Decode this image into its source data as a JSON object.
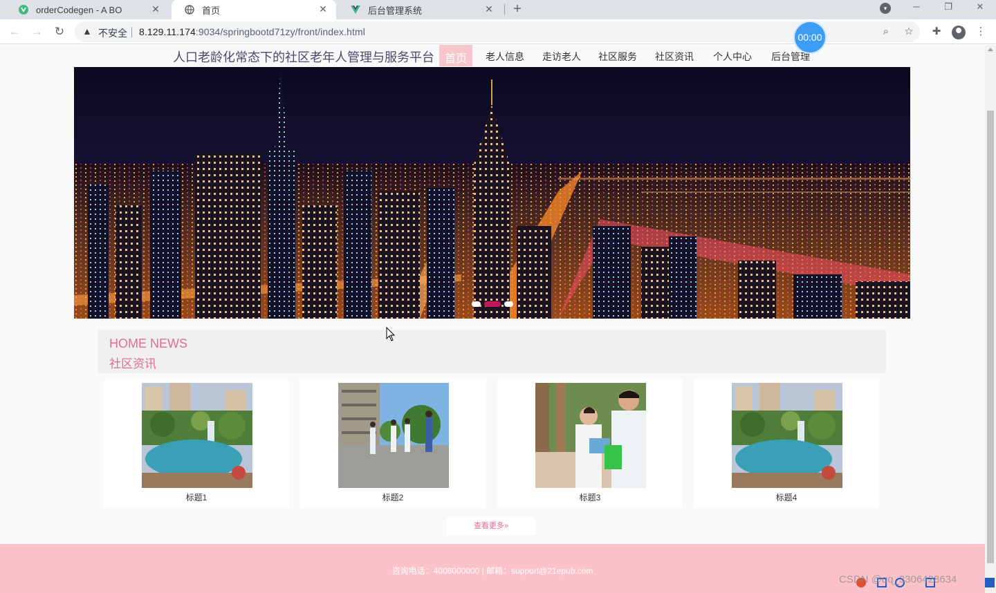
{
  "browser": {
    "tabs": [
      {
        "title": "orderCodegen - A BO",
        "icon": "vue-icon",
        "active": false
      },
      {
        "title": "首页",
        "icon": "globe-icon",
        "active": true
      },
      {
        "title": "后台管理系统",
        "icon": "vue-icon",
        "active": false
      }
    ],
    "address": {
      "security_label": "不安全",
      "host": "8.129.11.174",
      "path": ":9034/springbootd71zy/front/index.html"
    },
    "timer": "00:00"
  },
  "site": {
    "title": "人口老龄化常态下的社区老年人管理与服务平台",
    "nav": [
      {
        "label": "首页",
        "active": true
      },
      {
        "label": "老人信息",
        "active": false
      },
      {
        "label": "走访老人",
        "active": false
      },
      {
        "label": "社区服务",
        "active": false
      },
      {
        "label": "社区资讯",
        "active": false
      },
      {
        "label": "个人中心",
        "active": false
      },
      {
        "label": "后台管理",
        "active": false
      }
    ],
    "carousel": {
      "slide_count": 3,
      "active_index": 1
    },
    "news": {
      "heading_en": "HOME NEWS",
      "heading_cn": "社区资讯",
      "items": [
        {
          "title": "标题1",
          "image": "garden-pond"
        },
        {
          "title": "标题2",
          "image": "people-walking"
        },
        {
          "title": "标题3",
          "image": "volunteers"
        },
        {
          "title": "标题4",
          "image": "garden-pond"
        }
      ],
      "more_label": "查看更多"
    },
    "footer": "咨询电话：4008000000 | 邮箱：support@21epub.com"
  },
  "overlay": {
    "watermark": "CSDN @qq_3306428634"
  },
  "colors": {
    "accent": "#e86a92",
    "nav_active_bg": "#f7c6cd",
    "footer_bg": "#fbc2cb",
    "carousel_active": "#c2185b"
  }
}
